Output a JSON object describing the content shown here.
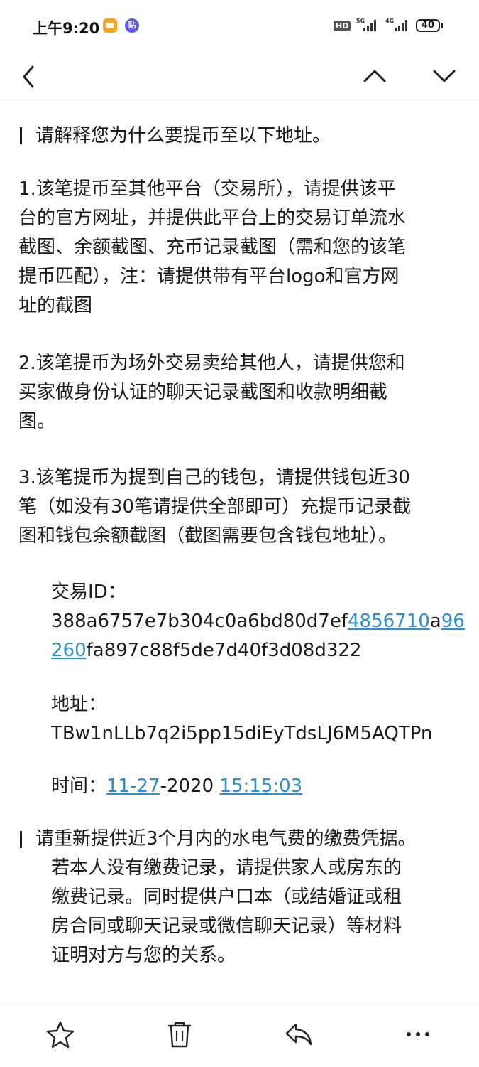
{
  "status_bar": {
    "time": "上午9:20",
    "hd": "HD",
    "network_1": "5G",
    "network_2": "4G",
    "battery": "40",
    "icons": [
      "notes-app-icon",
      "app-icon"
    ]
  },
  "nav": {
    "back_icon": "chevron-left-icon",
    "prev_icon": "chevron-up-icon",
    "next_icon": "chevron-down-icon"
  },
  "content": {
    "section1_title": "请解释您为什么要提币至以下地址。",
    "item1_lines": [
      "1.该笔提币至其他平台（交易所），请提供该平",
      "台的官方网址，并提供此平台上的交易订单流水",
      "截图、余额截图、充币记录截图（需和您的该笔",
      "提币匹配），注：请提供带有平台logo和官方网",
      "址的截图"
    ],
    "item2_lines": [
      "2.该笔提币为场外交易卖给其他人，请提供您和",
      "买家做身份认证的聊天记录截图和收款明细截",
      "图。"
    ],
    "item3_lines": [
      "3.该笔提币为提到自己的钱包，请提供钱包近30",
      "笔（如没有30笔请提供全部即可）充提币记录截",
      "图和钱包余额截图（截图需要包含钱包地址）。"
    ],
    "txid_label": "交易ID：",
    "txid_part1": "388a6757e7b304c0a6bd80d7ef",
    "txid_link1": "4856710",
    "txid_part2": "a",
    "txid_link2a": "96",
    "txid_link2b": "260",
    "txid_part3": "fa897c88f5de7d40f3d08d322",
    "address_label": "地址：",
    "address_value": "TBw1nLLb7q2i5pp15diEyTdsLJ6M5AQTPn",
    "time_label": "时间：",
    "time_link_date": "11-27",
    "time_year": "-2020 ",
    "time_link_clock": "15:15:03",
    "section2_lines": [
      "请重新提供近3个月内的水电气费的缴费凭据。",
      "若本人没有缴费记录，请提供家人或房东的",
      "缴费记录。同时提供户口本（或结婚证或租",
      "房合同或聊天记录或微信聊天记录）等材料",
      "证明对方与您的关系。"
    ]
  },
  "bottom_bar": {
    "star_icon": "star-icon",
    "delete_icon": "trash-icon",
    "reply_icon": "reply-icon",
    "more_icon": "more-icon"
  },
  "colors": {
    "link": "#2c8fd0",
    "text": "#1a1a1a",
    "divider": "#ededed"
  }
}
